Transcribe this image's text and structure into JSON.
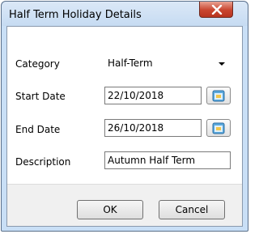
{
  "window": {
    "title": "Half Term Holiday Details",
    "close_glyph": "X"
  },
  "form": {
    "category_label": "Category",
    "category_value": "Half-Term",
    "start_label": "Start Date",
    "start_value": "22/10/2018",
    "end_label": "End Date",
    "end_value": "26/10/2018",
    "description_label": "Description",
    "description_value": "Autumn Half Term"
  },
  "buttons": {
    "ok": "OK",
    "cancel": "Cancel"
  },
  "icons": {
    "calendar_button": "calendar-icon",
    "close": "close-icon",
    "dropdown": "chevron-down-icon"
  },
  "colors": {
    "close_button": "#c9452f",
    "titlebar": "#c6dbf2",
    "client": "#f0f0f0"
  }
}
